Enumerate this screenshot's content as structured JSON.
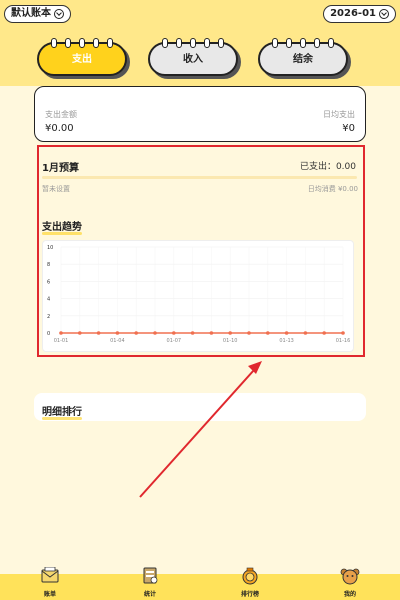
{
  "topbar": {
    "account_label": "默认账本",
    "month_label": "2026-01"
  },
  "tabs": [
    {
      "label": "支出",
      "active": true
    },
    {
      "label": "收入",
      "active": false
    },
    {
      "label": "结余",
      "active": false
    }
  ],
  "summary": {
    "expense_label": "支出金额",
    "expense_value": "¥0.00",
    "daily_label": "日均支出",
    "daily_value": "¥0"
  },
  "budget": {
    "title": "1月预算",
    "spent": "已支出：0.00",
    "note": "暂未设置",
    "daily": "日均消费 ¥0.00"
  },
  "trend": {
    "title": "支出趋势"
  },
  "ranking": {
    "title": "明细排行"
  },
  "chart_data": {
    "type": "line",
    "x": [
      "01-01",
      "01-02",
      "01-03",
      "01-04",
      "01-05",
      "01-06",
      "01-07",
      "01-08",
      "01-09",
      "01-10",
      "01-11",
      "01-12",
      "01-13",
      "01-14",
      "01-15",
      "01-16"
    ],
    "tick_labels": [
      "01-01",
      "01-04",
      "01-07",
      "01-10",
      "01-13",
      "01-16"
    ],
    "values": [
      0,
      0,
      0,
      0,
      0,
      0,
      0,
      0,
      0,
      0,
      0,
      0,
      0,
      0,
      0,
      0
    ],
    "yticks": [
      0,
      2,
      4,
      6,
      8,
      10
    ],
    "ylim": [
      0,
      10
    ],
    "grid": true,
    "color": "#f07050"
  },
  "bottom_nav": [
    {
      "label": "账单",
      "icon": "bill-icon"
    },
    {
      "label": "统计",
      "icon": "stats-icon"
    },
    {
      "label": "排行榜",
      "icon": "ranking-icon"
    },
    {
      "label": "我的",
      "icon": "profile-icon"
    }
  ],
  "colors": {
    "accent": "#ffd21c",
    "highlight": "#e0282e"
  }
}
